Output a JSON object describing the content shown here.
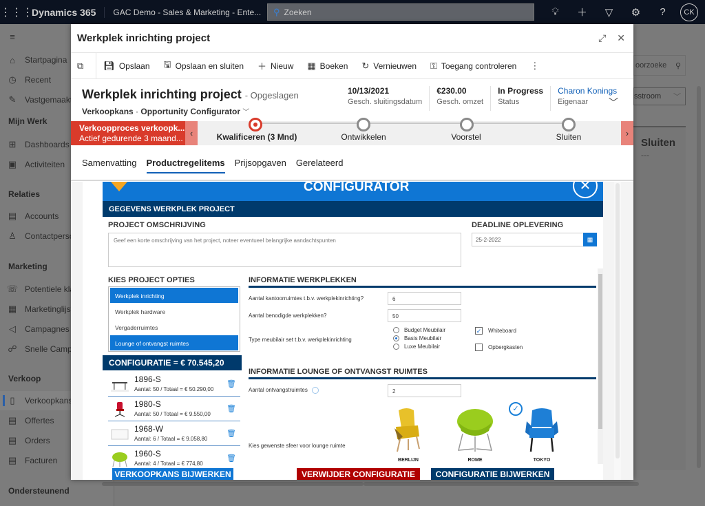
{
  "topbar": {
    "brand": "Dynamics 365",
    "app_name": "GAC Demo - Sales & Marketing - Ente...",
    "search_placeholder": "Zoeken",
    "avatar_initials": "CK"
  },
  "sidebar": {
    "items": [
      {
        "label": "Startpagina",
        "icon": "home-icon"
      },
      {
        "label": "Recent",
        "icon": "clock-icon"
      },
      {
        "label": "Vastgemaakt",
        "icon": "pin-icon"
      }
    ],
    "groups": [
      {
        "title": "Mijn Werk",
        "items": [
          {
            "label": "Dashboards",
            "icon": "dashboard-icon"
          },
          {
            "label": "Activiteiten",
            "icon": "clipboard-icon"
          }
        ]
      },
      {
        "title": "Relaties",
        "items": [
          {
            "label": "Accounts",
            "icon": "account-icon"
          },
          {
            "label": "Contactpersonen",
            "icon": "person-icon"
          }
        ]
      },
      {
        "title": "Marketing",
        "items": [
          {
            "label": "Potentiele klanten",
            "icon": "lead-icon"
          },
          {
            "label": "Marketinglijsten",
            "icon": "list-icon"
          },
          {
            "label": "Campagnes",
            "icon": "megaphone-icon"
          },
          {
            "label": "Snelle Campagnes",
            "icon": "quick-campaign-icon"
          }
        ]
      },
      {
        "title": "Verkoop",
        "items": [
          {
            "label": "Verkoopkansen",
            "icon": "opportunity-icon",
            "active": true
          },
          {
            "label": "Offertes",
            "icon": "quote-icon"
          },
          {
            "label": "Orders",
            "icon": "order-icon"
          },
          {
            "label": "Facturen",
            "icon": "invoice-icon"
          }
        ]
      },
      {
        "title": "Ondersteunend",
        "items": []
      }
    ]
  },
  "background": {
    "search_text": "oorzoeke",
    "dropdown_text": "sstroom",
    "card_title": "Sluiten",
    "card_value": "---"
  },
  "dialog": {
    "title": "Werkplek inrichting project",
    "commands": [
      "Opslaan",
      "Opslaan en sluiten",
      "Nieuw",
      "Boeken",
      "Vernieuwen",
      "Toegang controleren"
    ],
    "header": {
      "title": "Werkplek inrichting project",
      "saved": "- Opgeslagen",
      "entity": "Verkoopkans",
      "form": "Opportunity Configurator",
      "fields": [
        {
          "value": "10/13/2021",
          "label": "Gesch. sluitingsdatum"
        },
        {
          "value": "€230.00",
          "label": "Gesch. omzet"
        },
        {
          "value": "In Progress",
          "label": "Status"
        },
        {
          "value": "Charon Konings",
          "label": "Eigenaar"
        }
      ]
    },
    "bpf": {
      "process_name": "Verkoopproces verkoopk...",
      "process_status": "Actief gedurende 3 maand...",
      "stages": [
        {
          "label": "Kwalificeren  (3 Mnd)",
          "active": true
        },
        {
          "label": "Ontwikkelen",
          "active": false
        },
        {
          "label": "Voorstel",
          "active": false
        },
        {
          "label": "Sluiten",
          "active": false
        }
      ]
    },
    "tabs": [
      {
        "label": "Samenvatting",
        "active": false
      },
      {
        "label": "Productregelitems",
        "active": true
      },
      {
        "label": "Prijsopgaven",
        "active": false
      },
      {
        "label": "Gerelateerd",
        "active": false
      }
    ]
  },
  "configurator": {
    "banner_title": "CONFIGURATOR",
    "section_title": "GEGEVENS WERKPLEK PROJECT",
    "project_description_label": "PROJECT OMSCHRIJVING",
    "project_description_placeholder": "Geef een korte omschrijving van het project, noteer eventueel belangrijke aandachtspunten",
    "deadline_label": "DEADLINE OPLEVERING",
    "deadline_value": "25-2-2022",
    "options_label": "KIES PROJECT OPTIES",
    "options": [
      {
        "label": "Werkplek inrichting",
        "selected": true
      },
      {
        "label": "Werkplek hardware",
        "selected": false
      },
      {
        "label": "Vergaderruimtes",
        "selected": false
      },
      {
        "label": "Lounge of ontvangst ruimtes",
        "selected": true
      }
    ],
    "configuration_total": "CONFIGURATIE = € 70.545,20",
    "line_items": [
      {
        "code": "1896-S",
        "detail": "Aantal: 50 / Totaal = € 50.290,00",
        "thumb": "desk"
      },
      {
        "code": "1980-S",
        "detail": "Aantal: 50 / Totaal = € 9.550,00",
        "thumb": "office-chair"
      },
      {
        "code": "1968-W",
        "detail": "Aantal: 6 / Totaal = € 9.058,80",
        "thumb": "whiteboard"
      },
      {
        "code": "1960-S",
        "detail": "Aantal: 4 / Totaal = € 774,80",
        "thumb": "lounge-chair"
      }
    ],
    "workspaces": {
      "title": "INFORMATIE WERKPLEKKEN",
      "office_rooms_label": "Aantal kantoorruimtes t.b.v. werkplekinrichting?",
      "office_rooms_value": "6",
      "workplaces_label": "Aantal benodigde werkplekken?",
      "workplaces_value": "50",
      "furniture_label": "Type meubilair set t.b.v. werkplekinrichting",
      "furniture_options": [
        {
          "label": "Budget Meubilair",
          "checked": false
        },
        {
          "label": "Basis Meubilair",
          "checked": true
        },
        {
          "label": "Luxe Meubilair",
          "checked": false
        }
      ],
      "extras": [
        {
          "label": "Whiteboard",
          "checked": true
        },
        {
          "label": "Opbergkasten",
          "checked": false
        }
      ]
    },
    "lounge": {
      "title": "INFORMATIE LOUNGE OF ONTVANGST RUIMTES",
      "rooms_label": "Aantal ontvangstruimtes",
      "rooms_value": "2",
      "style_label": "Kies gewenste sfeer voor lounge ruimte",
      "styles": [
        {
          "label": "BERLIJN",
          "color": "#e8c12a",
          "selected": false
        },
        {
          "label": "ROME",
          "color": "#9acd1e",
          "selected": true
        },
        {
          "label": "TOKYO",
          "color": "#1e7fd6",
          "selected": false
        }
      ]
    },
    "buttons": {
      "update_opportunity": "VERKOOPKANS BIJWERKEN",
      "delete_configuration": "VERWIJDER CONFIGURATIE",
      "update_configuration": "CONFIGURATIE BIJWERKEN"
    }
  }
}
